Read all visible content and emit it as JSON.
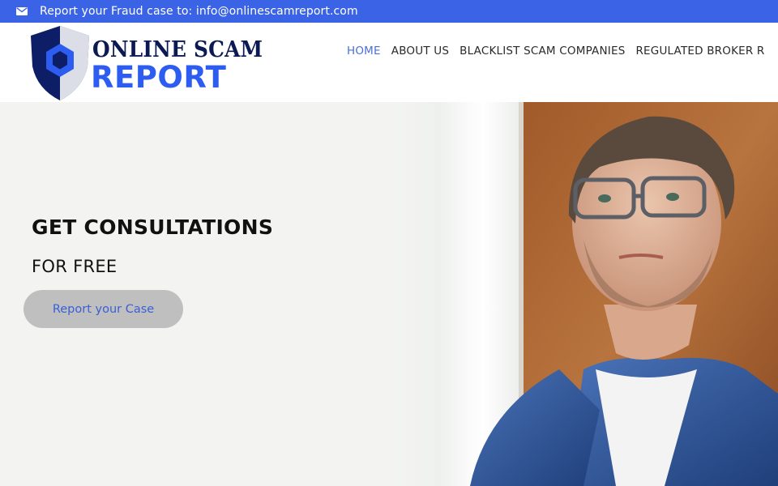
{
  "topbar": {
    "icon": "envelope-icon",
    "text": "Report your Fraud case to: info@onlinescamreport.com",
    "background": "#3a63e6"
  },
  "logo": {
    "line1": "ONLINE SCAM",
    "line2": "REPORT"
  },
  "nav": {
    "items": [
      {
        "label": "HOME",
        "active": true
      },
      {
        "label": "ABOUT US",
        "active": false
      },
      {
        "label": "BLACKLIST SCAM COMPANIES",
        "active": false
      },
      {
        "label": "REGULATED BROKER R",
        "active": false
      }
    ],
    "active_color": "#4a6fd8"
  },
  "hero": {
    "title": "GET CONSULTATIONS",
    "subtitle": "FOR FREE",
    "cta_label": "Report your Case"
  }
}
